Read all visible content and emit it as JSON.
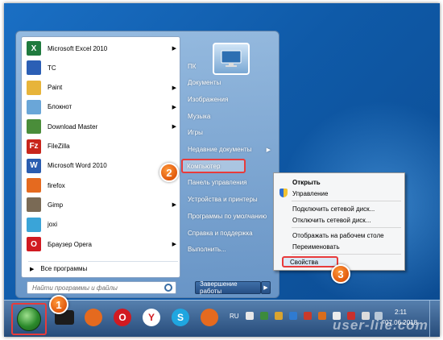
{
  "programs": [
    {
      "label": "Microsoft Excel 2010",
      "icon": "excel-icon",
      "color": "#1f7a3e",
      "glyph": "X",
      "submenu": true
    },
    {
      "label": "TC",
      "icon": "totalcommander-icon",
      "color": "#2b5fb5",
      "glyph": "",
      "submenu": false
    },
    {
      "label": "Paint",
      "icon": "paint-icon",
      "color": "#e7b43a",
      "glyph": "",
      "submenu": true
    },
    {
      "label": "Блокнот",
      "icon": "notepad-icon",
      "color": "#6aa6d8",
      "glyph": "",
      "submenu": true
    },
    {
      "label": "Download Master",
      "icon": "download-master-icon",
      "color": "#4a8d3a",
      "glyph": "",
      "submenu": true
    },
    {
      "label": "FileZilla",
      "icon": "filezilla-icon",
      "color": "#c8251b",
      "glyph": "Fz",
      "submenu": false
    },
    {
      "label": "Microsoft Word 2010",
      "icon": "word-icon",
      "color": "#2a5db0",
      "glyph": "W",
      "submenu": true
    },
    {
      "label": "firefox",
      "icon": "firefox-icon",
      "color": "#e56a1f",
      "glyph": "",
      "submenu": false
    },
    {
      "label": "Gimp",
      "icon": "gimp-icon",
      "color": "#7a6a55",
      "glyph": "",
      "submenu": true
    },
    {
      "label": "joxi",
      "icon": "joxi-icon",
      "color": "#3aa4d8",
      "glyph": "",
      "submenu": false
    },
    {
      "label": "Браузер Opera",
      "icon": "opera-icon",
      "color": "#d11a21",
      "glyph": "O",
      "submenu": true
    }
  ],
  "all_programs": "Все программы",
  "search_placeholder": "Найти программы и файлы",
  "right_items": [
    {
      "label": "ПК",
      "submenu": false
    },
    {
      "label": "Документы",
      "submenu": false
    },
    {
      "label": "Изображения",
      "submenu": false
    },
    {
      "label": "Музыка",
      "submenu": false
    },
    {
      "label": "Игры",
      "submenu": false
    },
    {
      "label": "Недавние документы",
      "submenu": true
    },
    {
      "label": "Компьютер",
      "submenu": false
    },
    {
      "label": "Панель управления",
      "submenu": false
    },
    {
      "label": "Устройства и принтеры",
      "submenu": false
    },
    {
      "label": "Программы по умолчанию",
      "submenu": false
    },
    {
      "label": "Справка и поддержка",
      "submenu": false
    },
    {
      "label": "Выполнить...",
      "submenu": false
    }
  ],
  "shutdown_label": "Завершение работы",
  "context_menu": {
    "open": "Открыть",
    "manage": "Управление",
    "map_drive": "Подключить сетевой диск...",
    "disconnect_drive": "Отключить сетевой диск...",
    "show_desktop": "Отображать на рабочем столе",
    "rename": "Переименовать",
    "properties": "Свойства"
  },
  "taskbar": {
    "apps": [
      {
        "icon": "firefox-icon",
        "color": "#e56a1f",
        "glyph": ""
      },
      {
        "icon": "opera-icon",
        "color": "#d11a21",
        "glyph": "O"
      },
      {
        "icon": "yandex-browser-icon",
        "color": "#ffffff",
        "glyph": "Y"
      },
      {
        "icon": "skype-icon",
        "color": "#1fa6e0",
        "glyph": "S"
      },
      {
        "icon": "firefox-icon",
        "color": "#e56a1f",
        "glyph": ""
      }
    ],
    "language": "RU",
    "time": "2:11",
    "date": "07.06.2018"
  },
  "callouts": [
    "1",
    "2",
    "3"
  ],
  "watermark": "user-life.com",
  "colors": {
    "highlight": "#e83b3b",
    "callout": "#f07a1e",
    "desktop": "#1464b4"
  }
}
